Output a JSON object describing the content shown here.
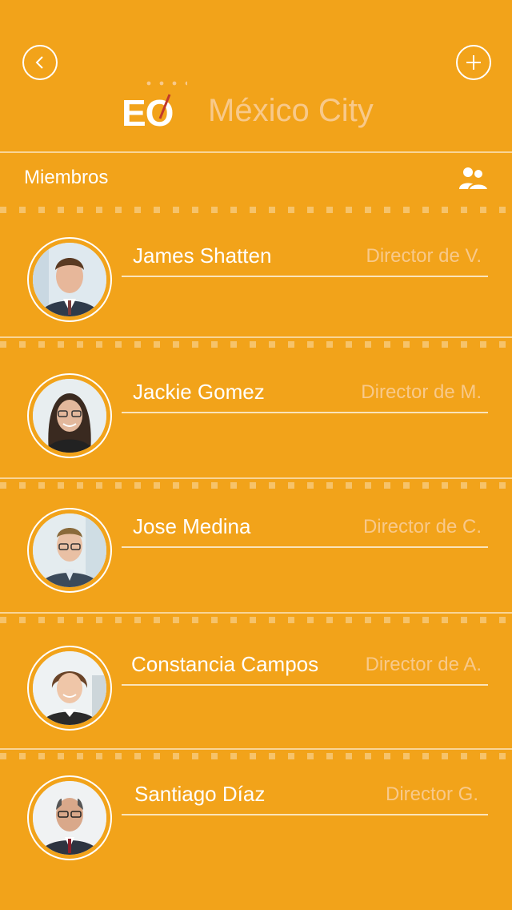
{
  "header": {
    "logo_text": "EO",
    "city": "México City"
  },
  "section": {
    "title": "Miembros",
    "icon": "group-users-icon"
  },
  "members": [
    {
      "name": "James Shatten",
      "role": "Director de V."
    },
    {
      "name": "Jackie Gomez",
      "role": "Director de M."
    },
    {
      "name": "Jose Medina",
      "role": "Director de C."
    },
    {
      "name": "Constancia Campos",
      "role": "Director de A."
    },
    {
      "name": "Santiago Díaz",
      "role": "Director G."
    }
  ],
  "colors": {
    "background": "#F2A31A",
    "role_text": "#F8C98A",
    "city_text": "#F8C98A",
    "logo_accent": "#C0392B"
  }
}
